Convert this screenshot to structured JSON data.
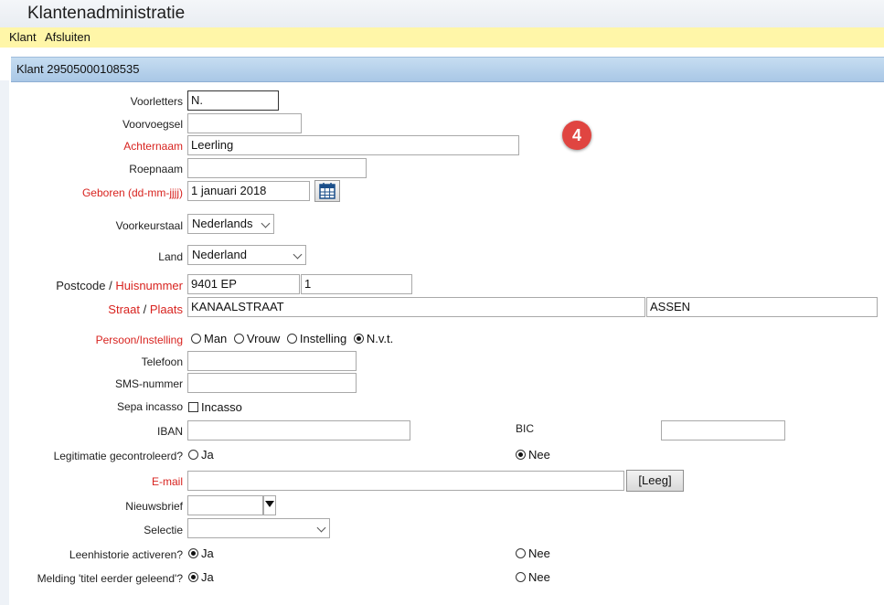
{
  "app": {
    "title": "Klantenadministratie"
  },
  "menu": {
    "items": [
      "Klant",
      "Afsluiten"
    ]
  },
  "panel": {
    "title": "Klant 29505000108535"
  },
  "badge": {
    "number": "4",
    "color": "#e04541"
  },
  "form": {
    "voorletters": {
      "label": "Voorletters",
      "value": "N."
    },
    "voorvoegsel": {
      "label": "Voorvoegsel",
      "value": ""
    },
    "achternaam": {
      "label": "Achternaam",
      "value": "Leerling"
    },
    "roepnaam": {
      "label": "Roepnaam",
      "value": ""
    },
    "geboren": {
      "label": "Geboren (dd-mm-jjjj)",
      "value": "1 januari 2018"
    },
    "voorkeurstaal": {
      "label": "Voorkeurstaal",
      "selected": "Nederlands"
    },
    "land": {
      "label": "Land",
      "selected": "Nederland"
    },
    "postcode": {
      "label": "Postcode",
      "separator": "/",
      "label2": "Huisnummer",
      "value": "9401 EP",
      "value2": "1"
    },
    "straat": {
      "label": "Straat",
      "separator": "/",
      "label2": "Plaats",
      "value": "KANAALSTRAAT",
      "value2": "ASSEN"
    },
    "persoon": {
      "label": "Persoon/Instelling",
      "options": [
        "Man",
        "Vrouw",
        "Instelling",
        "N.v.t."
      ],
      "selected": "N.v.t."
    },
    "telefoon": {
      "label": "Telefoon",
      "value": ""
    },
    "sms": {
      "label": "SMS-nummer",
      "value": ""
    },
    "sepa": {
      "label": "Sepa incasso",
      "checkbox_label": "Incasso",
      "checked": false
    },
    "iban": {
      "label": "IBAN",
      "value": ""
    },
    "bic": {
      "label": "BIC",
      "value": ""
    },
    "legitimatie": {
      "label": "Legitimatie gecontroleerd?",
      "yes": "Ja",
      "no": "Nee",
      "selected": "Nee"
    },
    "email": {
      "label": "E-mail",
      "value": "",
      "clear_button": "[Leeg]"
    },
    "nieuwsbrief": {
      "label": "Nieuwsbrief",
      "selected": ""
    },
    "selectie": {
      "label": "Selectie",
      "selected": ""
    },
    "leenhistorie": {
      "label": "Leenhistorie activeren?",
      "yes": "Ja",
      "no": "Nee",
      "selected": "Ja"
    },
    "melding": {
      "label": "Melding 'titel eerder geleend'?",
      "yes": "Ja",
      "no": "Nee",
      "selected": "Ja"
    }
  },
  "colors": {
    "required_label": "#d8231f",
    "menubar": "#fff6a8",
    "panel_header": "#b8d2ee"
  }
}
